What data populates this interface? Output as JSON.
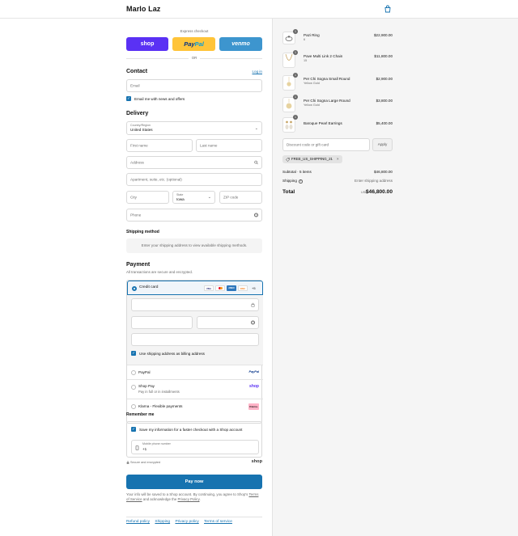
{
  "brand": "Marlo Laz",
  "express": {
    "title": "Express checkout",
    "shop": "shop",
    "paypal_a": "Pay",
    "paypal_b": "Pal",
    "venmo": "venmo",
    "or": "OR"
  },
  "contact": {
    "title": "Contact",
    "login": "Log in",
    "email_placeholder": "Email",
    "news_label": "Email me with news and offers"
  },
  "delivery": {
    "title": "Delivery",
    "country_label": "Country/Region",
    "country_value": "United States",
    "first_name": "First name",
    "last_name": "Last name",
    "address": "Address",
    "apartment": "Apartment, suite, etc. (optional)",
    "city": "City",
    "state_label": "State",
    "state_value": "Iowa",
    "zip": "ZIP code",
    "phone": "Phone"
  },
  "shipping": {
    "title": "Shipping method",
    "message": "Enter your shipping address to view available shipping methods."
  },
  "payment": {
    "title": "Payment",
    "subtitle": "All transactions are secure and encrypted.",
    "credit_card": "Credit card",
    "card_logos": [
      "VISA",
      "MC",
      "AMEX",
      "DISC"
    ],
    "more_cards": "+5",
    "billing_label": "Use shipping address as billing address",
    "paypal": "PayPal",
    "paypal_logo": "PayPal",
    "shop_pay": "Shop Pay",
    "shop_pay_sub": "Pay in full or in installments",
    "shop_logo": "shop",
    "klarna": "Klarna - Flexible payments",
    "klarna_logo": "Klarna."
  },
  "remember": {
    "title": "Remember me",
    "save_label": "Save my information for a faster checkout with a Shop account",
    "phone_label": "Mobile phone number",
    "phone_value": "+1",
    "secure": "Secure and encrypted",
    "shop_brand": "shop"
  },
  "pay_now": "Pay now",
  "legal": {
    "text1": "Your info will be saved to a Shop account. By continuing, you agree to Shop's",
    "terms": "Terms of Service",
    "text2": "and acknowledge the",
    "privacy": "Privacy Policy",
    "text3": "."
  },
  "footer": [
    "Refund policy",
    "Shipping",
    "Privacy policy",
    "Terms of service"
  ],
  "cart": {
    "items": [
      {
        "qty": "1",
        "name": "Pazi Ring",
        "variant": "6",
        "price": "$22,900.00"
      },
      {
        "qty": "1",
        "name": "Pave Multi Link 2 Chain",
        "variant": "15",
        "price": "$11,800.00"
      },
      {
        "qty": "1",
        "name": "Per Chi Sogna Small Round",
        "variant": "Yellow Gold",
        "price": "$2,900.00"
      },
      {
        "qty": "1",
        "name": "Per Chi Sogna Large Round",
        "variant": "Yellow Gold",
        "price": "$3,800.00"
      },
      {
        "qty": "1",
        "name": "Baroque Pearl Earrings",
        "variant": "",
        "price": "$5,400.00"
      }
    ],
    "discount_placeholder": "Discount code or gift card",
    "apply": "Apply",
    "code": "FREE_US_SHIPPING_21",
    "subtotal_label": "Subtotal · 5 items",
    "subtotal_value": "$46,800.00",
    "shipping_label": "Shipping",
    "shipping_value": "Enter shipping address",
    "total_label": "Total",
    "currency": "USD",
    "total_value": "$46,800.00"
  },
  "colors": {
    "accent": "#1773b0",
    "shop": "#5a31f4",
    "paypal": "#ffc439",
    "venmo": "#3d95ce"
  }
}
